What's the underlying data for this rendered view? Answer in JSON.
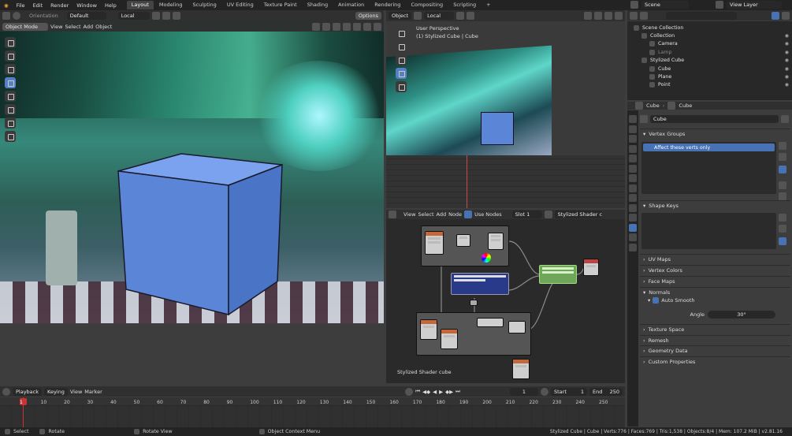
{
  "app": {
    "title": "Blender"
  },
  "menu": [
    "File",
    "Edit",
    "Render",
    "Window",
    "Help"
  ],
  "workspaces": [
    "Layout",
    "Modeling",
    "Sculpting",
    "UV Editing",
    "Texture Paint",
    "Shading",
    "Animation",
    "Rendering",
    "Compositing",
    "Scripting"
  ],
  "add_workspace": "+",
  "scene": {
    "name": "Scene",
    "view_layer": "View Layer"
  },
  "viewport_left": {
    "orientation_label": "Orientation",
    "orientation_value": "Default",
    "transform": "Local",
    "options": "Options",
    "mode": "Object Mode",
    "menu": [
      "View",
      "Select",
      "Add",
      "Object"
    ]
  },
  "viewport_right": {
    "mode": "Object",
    "transform": "Local",
    "perspective": "User Perspective",
    "object_info": "(1) Stylized Cube | Cube"
  },
  "node_editor": {
    "menu": [
      "View",
      "Select",
      "Add",
      "Node"
    ],
    "use_nodes": "Use Nodes",
    "slot": "Slot 1",
    "material": "Stylized Shader c",
    "label": "Stylized Shader cube"
  },
  "outliner": {
    "items": [
      {
        "label": "Scene Collection",
        "level": 0
      },
      {
        "label": "Collection",
        "level": 1
      },
      {
        "label": "Camera",
        "level": 2
      },
      {
        "label": "Lamp",
        "level": 2,
        "dim": true
      },
      {
        "label": "Stylized Cube",
        "level": 1
      },
      {
        "label": "Cube",
        "level": 2
      },
      {
        "label": "Plane",
        "level": 2
      },
      {
        "label": "Point",
        "level": 2
      }
    ]
  },
  "properties": {
    "breadcrumb_object": "Cube",
    "breadcrumb_data": "Cube",
    "data_name": "Cube",
    "vertex_groups_title": "Vertex Groups",
    "vertex_group_item": "Affect these verts only",
    "shape_keys_title": "Shape Keys",
    "sections": [
      "UV Maps",
      "Vertex Colors",
      "Face Maps"
    ],
    "normals_title": "Normals",
    "auto_smooth": "Auto Smooth",
    "angle_label": "Angle",
    "angle_value": "30°",
    "bottom_sections": [
      "Texture Space",
      "Remesh",
      "Geometry Data",
      "Custom Properties"
    ]
  },
  "timeline": {
    "menu": [
      "Playback",
      "Keying",
      "View",
      "Marker"
    ],
    "current_frame": "1",
    "start_label": "Start",
    "start": "1",
    "end_label": "End",
    "end": "250",
    "ticks": [
      "1",
      "10",
      "20",
      "30",
      "40",
      "50",
      "60",
      "70",
      "80",
      "90",
      "100",
      "110",
      "120",
      "130",
      "140",
      "150",
      "160",
      "170",
      "180",
      "190",
      "200",
      "210",
      "220",
      "230",
      "240",
      "250"
    ]
  },
  "status_bar": {
    "left": [
      "Select",
      "Rotate",
      "Rotate View",
      "Object Context Menu"
    ],
    "stats": "Stylized Cube | Cube | Verts:776 | Faces:769 | Tris:1,538 | Objects:8/4 | Mem: 107.2 MiB | v2.81.16"
  },
  "colors": {
    "accent": "#4772b3",
    "timeline_marker": "#c83434",
    "cube": "#5b86d8",
    "header": "#303030",
    "panel": "#3d3d3d"
  }
}
